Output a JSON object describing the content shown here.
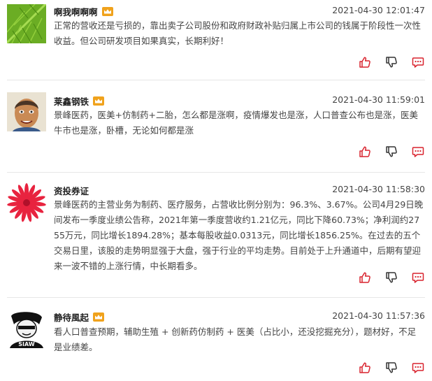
{
  "accent_color": "#d9232e",
  "vip_badge_color": "#f0a21c",
  "posts": [
    {
      "username": "啊我啊啊啊",
      "time": "2021-04-30 12:01:47",
      "content": "正常的营收还是亏损的，靠出卖子公司股份和政府财政补贴归属上市公司的钱属于阶段性一次性收益。但公司研发项目如果真实，长期利好！",
      "avatar_icon": "green-leaf-avatar"
    },
    {
      "username": "莱鑫钢铁",
      "time": "2021-04-30 11:59:01",
      "content": "景峰医药，医美+仿制药+二胎，怎么都是涨啊，疫情爆发也是涨，人口普查公布也是涨，医美牛市也是涨，卧槽，无论如何都是涨",
      "avatar_icon": "portrait-avatar"
    },
    {
      "username": "资投券证",
      "time": "2021-04-30 11:58:30",
      "content": "景峰医药的主营业务为制药、医疗服务，占营收比例分别为：96.3%、3.67%。公司4月29日晚间发布一季度业绩公告称，2021年第一季度营收约1.21亿元，同比下降60.73%；净利润约2755万元，同比增长1894.28%；基本每股收益0.0313元，同比增长1856.25%。在过去的五个交易日里，该股的走势明显强于大盘，强于行业的平均走势。目前处于上升通道中，后期有望迎来一波不错的上涨行情，中长期看多。",
      "avatar_icon": "red-flower-avatar"
    },
    {
      "username": "静待風起",
      "time": "2021-04-30 11:57:36",
      "content": "看人口普查预期，辅助生殖 + 创新药仿制药 + 医美（占比小，还没挖掘充分），题材好，不足是业绩差。",
      "avatar_icon": "sticker-avatar"
    }
  ]
}
